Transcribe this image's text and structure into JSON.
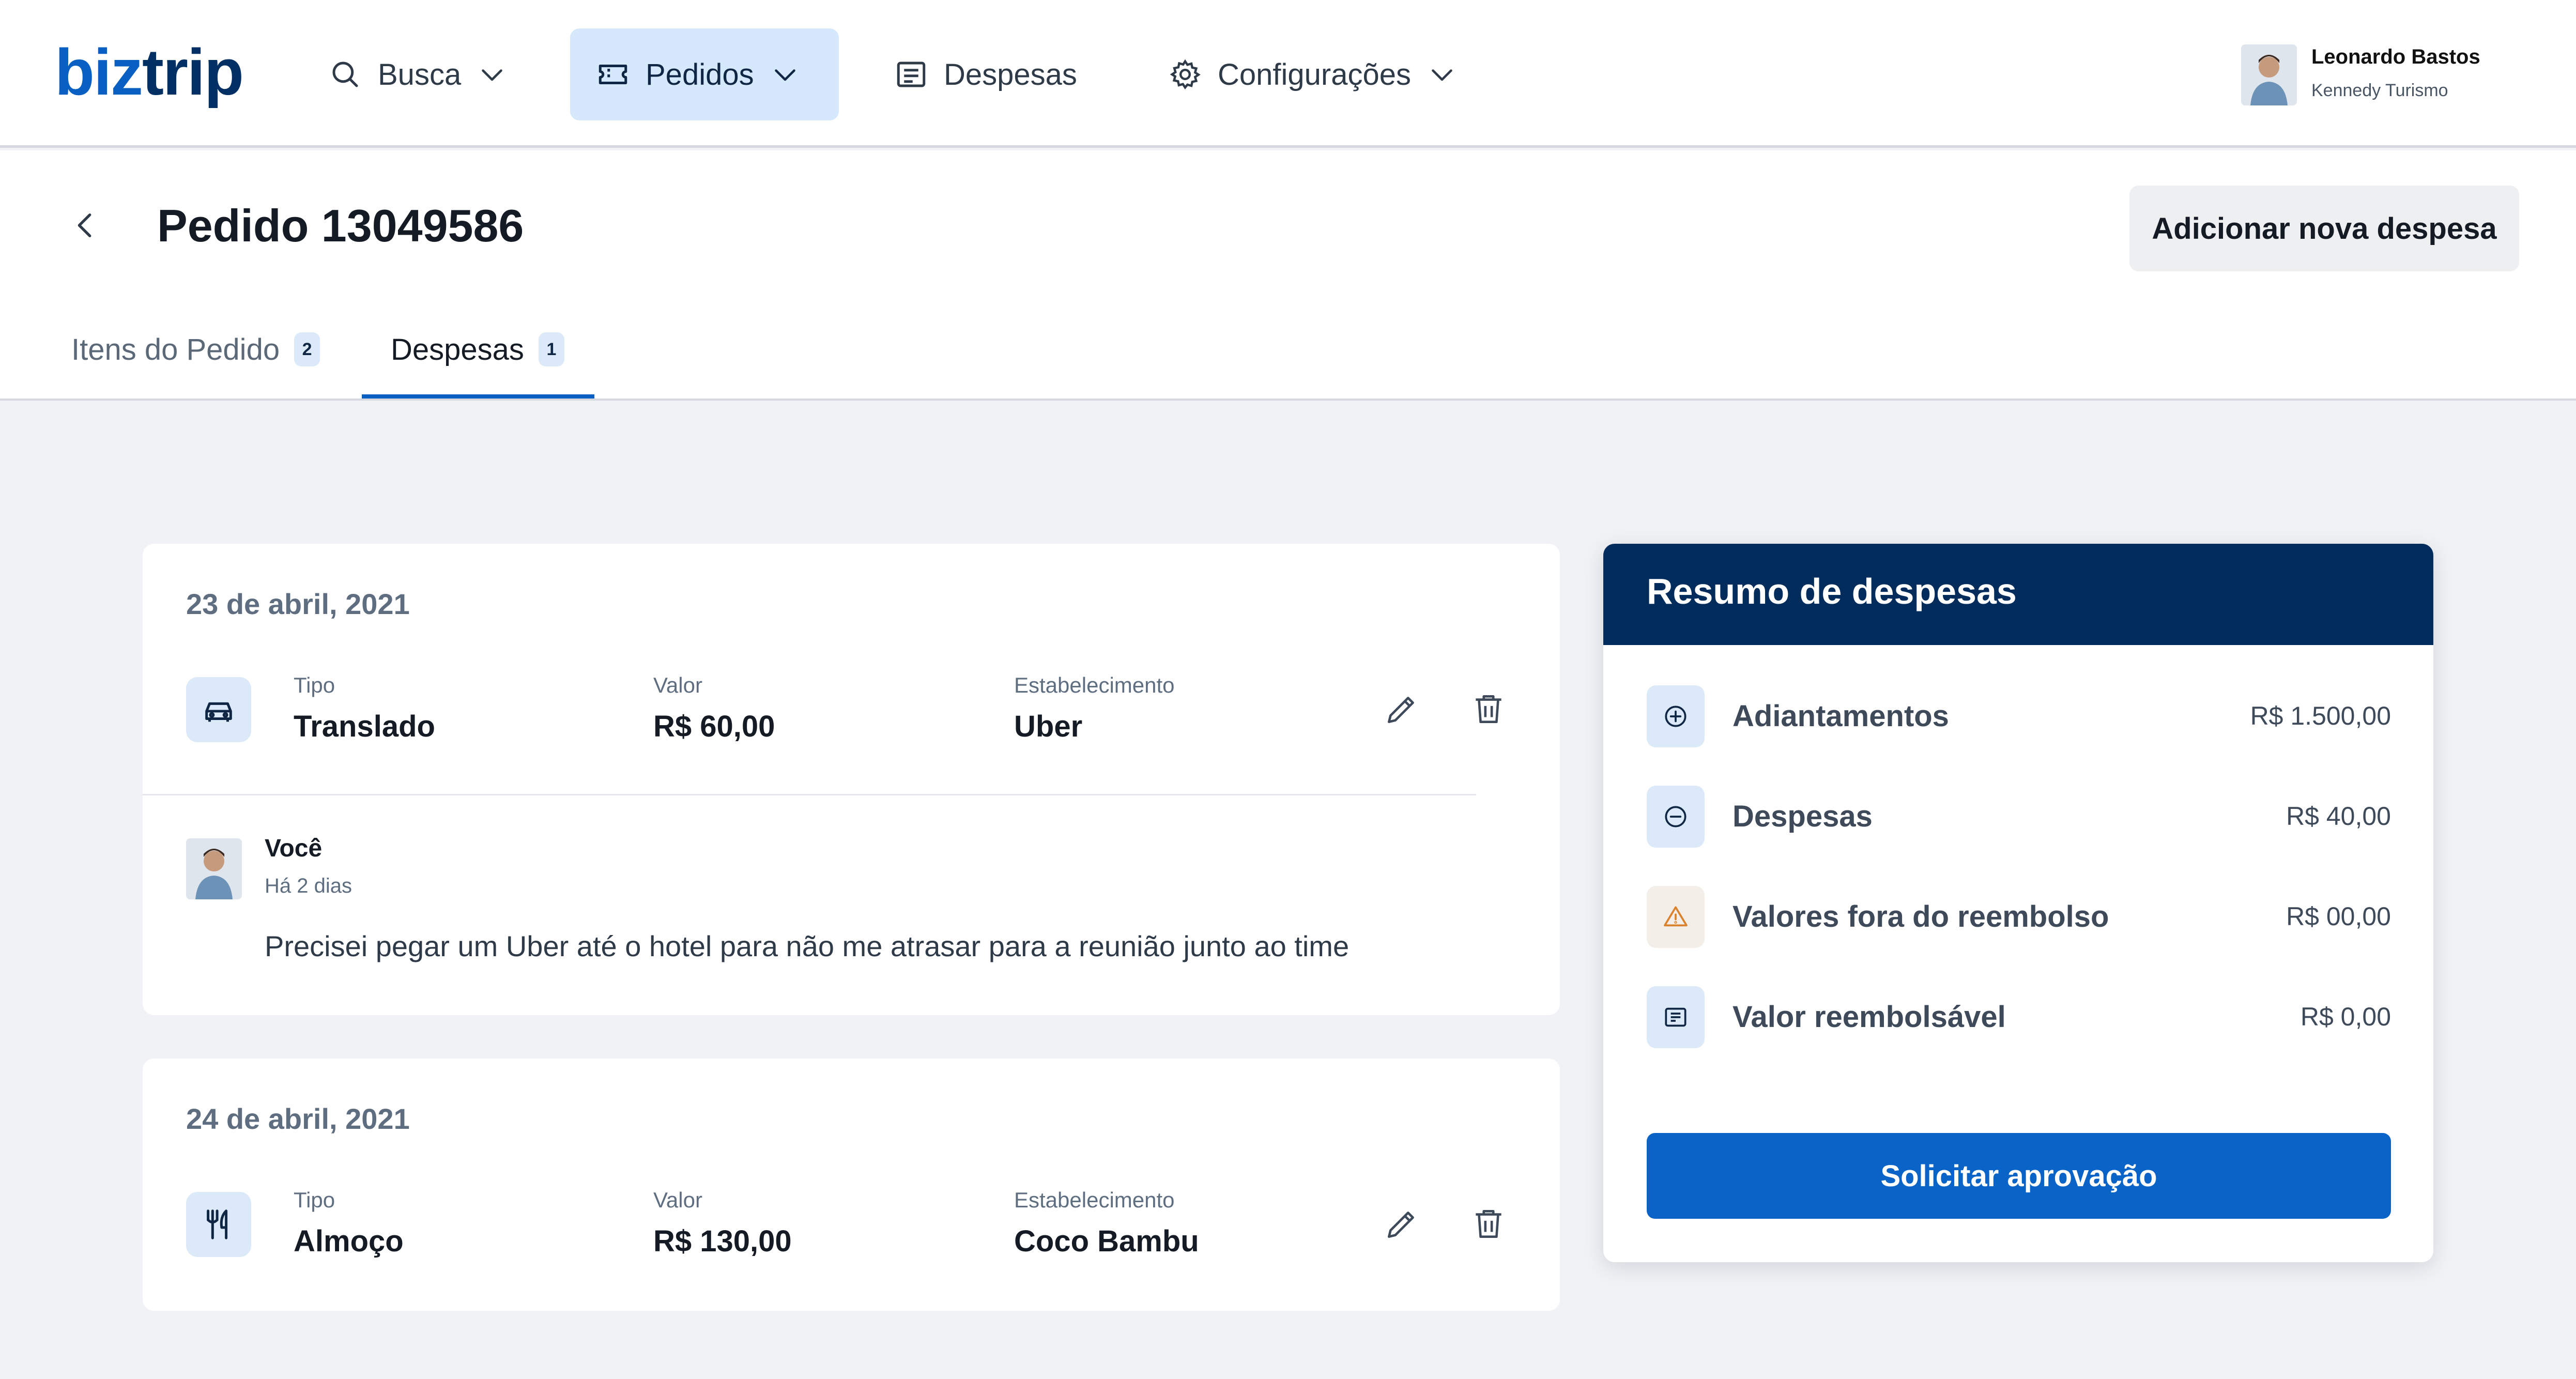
{
  "brand": {
    "part1": "biz",
    "part2": "trip"
  },
  "nav": {
    "items": [
      {
        "label": "Busca"
      },
      {
        "label": "Pedidos"
      },
      {
        "label": "Despesas"
      },
      {
        "label": "Configurações"
      }
    ],
    "user": {
      "name": "Leonardo Bastos",
      "company": "Kennedy Turismo"
    }
  },
  "page": {
    "title": "Pedido 13049586",
    "add_button": "Adicionar nova despesa",
    "tabs": [
      {
        "label": "Itens do Pedido",
        "count": "2"
      },
      {
        "label": "Despesas",
        "count": "1"
      }
    ]
  },
  "expenses": [
    {
      "date": "23 de abril, 2021",
      "icon": "car-icon",
      "type_label": "Tipo",
      "type": "Translado",
      "value_label": "Valor",
      "value": "R$ 60,00",
      "place_label": "Estabelecimento",
      "place": "Uber",
      "comment": {
        "author": "Você",
        "time": "Há 2 dias",
        "text": "Precisei pegar um Uber até o hotel para não me atrasar para a reunião junto ao time"
      }
    },
    {
      "date": "24 de abril, 2021",
      "icon": "utensils-icon",
      "type_label": "Tipo",
      "type": "Almoço",
      "value_label": "Valor",
      "value": "R$ 130,00",
      "place_label": "Estabelecimento",
      "place": "Coco Bambu"
    }
  ],
  "summary": {
    "title": "Resumo de despesas",
    "rows": [
      {
        "label": "Adiantamentos",
        "value": "R$ 1.500,00",
        "icon": "plus-circle-icon"
      },
      {
        "label": "Despesas",
        "value": "R$ 40,00",
        "icon": "minus-circle-icon"
      },
      {
        "label": "Valores fora do reembolso",
        "value": "R$ 00,00",
        "icon": "warning-icon"
      },
      {
        "label": "Valor reembolsável",
        "value": "R$ 0,00",
        "icon": "receipt-icon"
      }
    ],
    "button": "Solicitar aprovação"
  },
  "colors": {
    "primary": "#0a63c6",
    "navy": "#022c5c",
    "active_nav_bg": "#d6e8fb",
    "page_bg": "#f1f2f5",
    "warning": "#d9822b"
  }
}
